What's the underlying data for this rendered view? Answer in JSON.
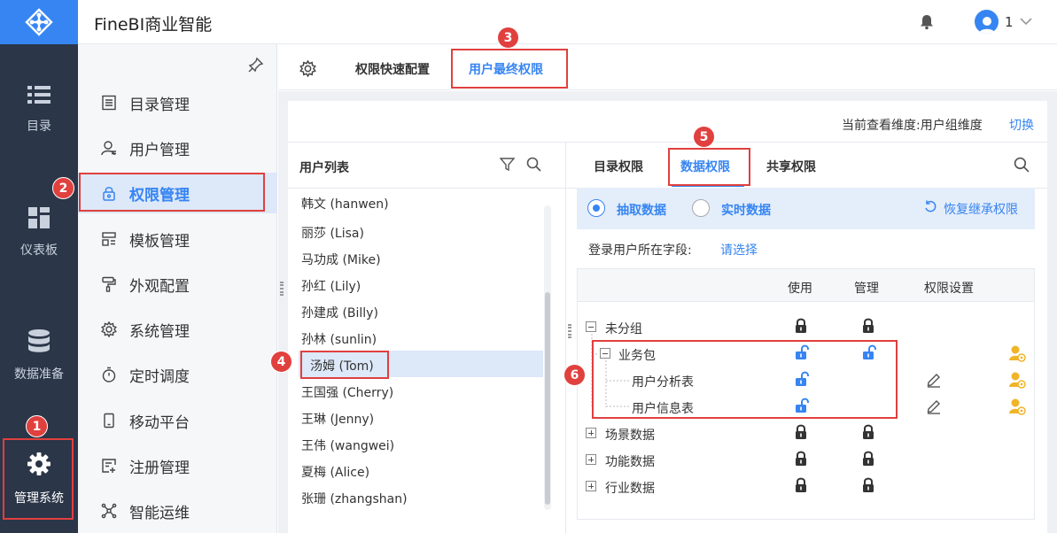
{
  "app": {
    "title": "FineBI商业智能",
    "user_name": "1"
  },
  "rail": [
    {
      "label": "目录",
      "icon": "list-icon"
    },
    {
      "label": "仪表板",
      "icon": "dashboard-icon"
    },
    {
      "label": "数据准备",
      "icon": "database-icon"
    },
    {
      "label": "管理系统",
      "icon": "gear-icon"
    }
  ],
  "submenu": [
    {
      "label": "目录管理",
      "icon": "catalog-icon"
    },
    {
      "label": "用户管理",
      "icon": "user-icon"
    },
    {
      "label": "权限管理",
      "icon": "lock-icon"
    },
    {
      "label": "模板管理",
      "icon": "template-icon"
    },
    {
      "label": "外观配置",
      "icon": "paint-roller-icon"
    },
    {
      "label": "系统管理",
      "icon": "gear-icon"
    },
    {
      "label": "定时调度",
      "icon": "timer-icon"
    },
    {
      "label": "移动平台",
      "icon": "mobile-icon"
    },
    {
      "label": "注册管理",
      "icon": "register-icon"
    },
    {
      "label": "智能运维",
      "icon": "ops-icon"
    }
  ],
  "tabs": {
    "quick": "权限快速配置",
    "final": "用户最终权限"
  },
  "dimension": {
    "label": "当前查看维度:用户组维度",
    "switch": "切换"
  },
  "user_list": {
    "title": "用户列表",
    "partial_top": "韩文 (hanwen)",
    "users": [
      "丽莎 (Lisa)",
      "马功成 (Mike)",
      "孙红 (Lily)",
      "孙建成 (Billy)",
      "孙林 (sunlin)",
      "汤姆 (Tom)",
      "王国强 (Cherry)",
      "王琳 (Jenny)",
      "王伟 (wangwei)",
      "夏梅 (Alice)",
      "张珊 (zhangshan)"
    ],
    "selected_index": 5
  },
  "perm_tabs": {
    "catalog": "目录权限",
    "data": "数据权限",
    "share": "共享权限"
  },
  "mode": {
    "extract": "抽取数据",
    "realtime": "实时数据",
    "selected": "抽取数据",
    "restore": "恢复继承权限"
  },
  "login_field": {
    "label": "登录用户所在字段:",
    "value": "请选择"
  },
  "tree_headers": {
    "use": "使用",
    "manage": "管理",
    "setting": "权限设置"
  },
  "tree": [
    {
      "label": "未分组",
      "use": "locked",
      "manage": "locked"
    },
    {
      "label": "业务包",
      "use": "unlocked",
      "manage": "unlocked"
    },
    {
      "label": "用户分析表",
      "use": "unlocked",
      "manage": ""
    },
    {
      "label": "用户信息表",
      "use": "unlocked",
      "manage": ""
    },
    {
      "label": "场景数据",
      "use": "locked",
      "manage": "locked"
    },
    {
      "label": "功能数据",
      "use": "locked",
      "manage": "locked"
    },
    {
      "label": "行业数据",
      "use": "locked",
      "manage": "locked"
    }
  ],
  "badges": [
    "1",
    "2",
    "3",
    "4",
    "5",
    "6"
  ],
  "colors": {
    "accent": "#3685f2",
    "rail_bg": "#2b3648",
    "highlight": "#e0403e",
    "person_icon": "#f0b429"
  }
}
